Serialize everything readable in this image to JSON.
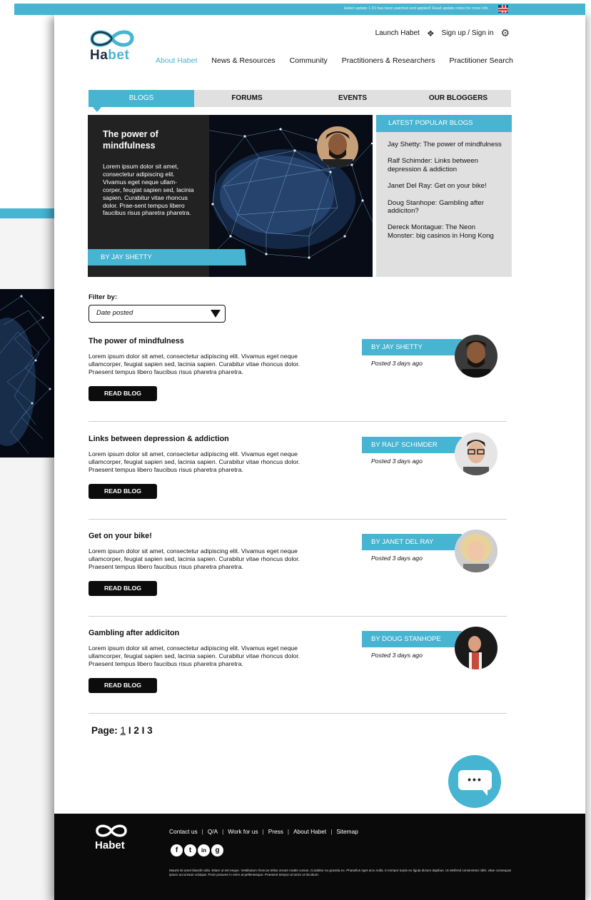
{
  "announcement": {
    "text": "Habet update 1.01 has been patched and applied! Read update notes for more info"
  },
  "brand": {
    "name_a": "Ha",
    "name_b": "bet"
  },
  "header": {
    "launch": "Launch Habet",
    "signin": "Sign up / Sign in",
    "nav": [
      "About Habet",
      "News & Resources",
      "Community",
      "Practitioners & Researchers",
      "Practitioner Search"
    ]
  },
  "tabs": [
    "BLOGS",
    "FORUMS",
    "EVENTS",
    "OUR BLOGGERS"
  ],
  "hero": {
    "title": "The power of mindfulness",
    "body": "Lorem ipsum dolor sit amet, consectetur adipiscing elit. Vivamus eget neque ullam-corper, feugiat sapien sed, lacinia sapien. Curabitur vitae rhoncus dolor. Prae-sent tempus libero faucibus risus pharetra pharetra.",
    "author": "BY JAY SHETTY"
  },
  "popular": {
    "heading": "LATEST POPULAR BLOGS",
    "items": [
      "Jay Shetty: The power of mindfulness",
      "Ralf Schimder: Links between depression & addiction",
      "Janet Del Ray: Get on your bike!",
      "Doug Stanhope: Gambling after addiciton?",
      "Dereck Montague: The Neon Monster: big casinos in Hong Kong"
    ]
  },
  "filter": {
    "label": "Filter by:",
    "value": "Date posted"
  },
  "posts": [
    {
      "title": "The power of mindfulness",
      "body": "Lorem ipsum dolor sit amet, consectetur adipiscing elit. Vivamus eget neque ullamcorper, feugiat sapien sed, lacinia sapien. Curabitur vitae rhoncus dolor. Praesent tempus libero faucibus risus pharetra pharetra.",
      "button": "READ BLOG",
      "author": "BY JAY SHETTY",
      "posted": "Posted 3 days ago"
    },
    {
      "title": "Links between depression & addiction",
      "body": "Lorem ipsum dolor sit amet, consectetur adipiscing elit. Vivamus eget neque ullamcorper, feugiat sapien sed, lacinia sapien. Curabitur vitae rhoncus dolor. Praesent tempus libero faucibus risus pharetra pharetra.",
      "button": "READ BLOG",
      "author": "BY RALF SCHIMDER",
      "posted": "Posted 3 days ago"
    },
    {
      "title": "Get on your bike!",
      "body": "Lorem ipsum dolor sit amet, consectetur adipiscing elit. Vivamus eget neque ullamcorper, feugiat sapien sed, lacinia sapien. Curabitur vitae rhoncus dolor. Praesent tempus libero faucibus risus pharetra pharetra.",
      "button": "READ BLOG",
      "author": "BY JANET DEL RAY",
      "posted": "Posted 3 days ago"
    },
    {
      "title": "Gambling after addiciton",
      "body": "Lorem ipsum dolor sit amet, consectetur adipiscing elit. Vivamus eget neque ullamcorper, feugiat sapien sed, lacinia sapien. Curabitur vitae rhoncus dolor. Praesent tempus libero faucibus risus pharetra pharetra.",
      "button": "READ BLOG",
      "author": "BY DOUG STANHOPE",
      "posted": "Posted 3 days ago"
    }
  ],
  "pagination": {
    "label": "Page:",
    "current": "1",
    "sep": "I",
    "pages": [
      "2",
      "3"
    ]
  },
  "chat": {
    "dots": "•••"
  },
  "footer": {
    "links": [
      "Contact us",
      "Q/A",
      "Work for us",
      "Press",
      "About Habet",
      "Sitemap"
    ],
    "sep": "|",
    "social": [
      "f",
      "t",
      "in",
      "g"
    ],
    "small": "Mauris sit amet blandit nulla. Etiam ut est neque. Vestibulum rhoncus tellus ornare mattis cursus. Curabitur eu gravida ex. Phasellus eget arcu nulla. In tempor turpis eu ligula dictum dapibus. Ut eleifend consectetur nibh, vitae consequat ipsum accumsan volutpat. Proin posuere in enim at pellentesque. Praesent tempor at tortor ut tincidunt."
  },
  "colors": {
    "accent": "#47b4d1",
    "dark": "#0a0a0a",
    "panel": "#e0e0e0"
  },
  "icons": [
    "habet-logo",
    "uk-flag-icon",
    "launch-icon",
    "gear-icon",
    "dropdown-triangle-icon",
    "chat-icon",
    "facebook-icon",
    "twitter-icon",
    "linkedin-icon",
    "meetup-icon"
  ]
}
